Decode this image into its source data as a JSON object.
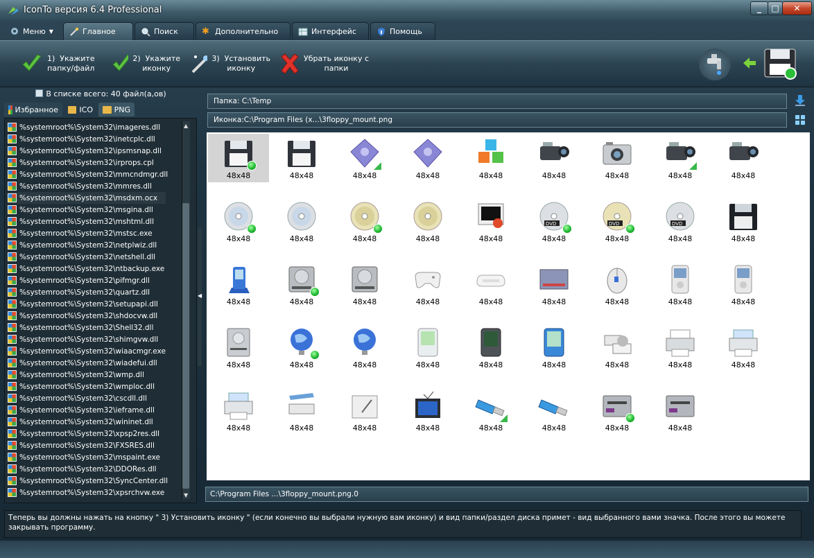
{
  "window": {
    "title": "IconTo версия 6.4 Professional",
    "min": "_",
    "max": "□",
    "close": "✕"
  },
  "tabs": [
    {
      "label": "Меню",
      "icon": "gear-drop-icon",
      "active": false
    },
    {
      "label": "Главное",
      "icon": "wand-icon",
      "active": true
    },
    {
      "label": "Поиск",
      "icon": "magnifier-icon",
      "active": false
    },
    {
      "label": "Дополнительно",
      "icon": "star-icon",
      "active": false
    },
    {
      "label": "Интерфейс",
      "icon": "grid-icon",
      "active": false
    },
    {
      "label": "Помощь",
      "icon": "shield-info-icon",
      "active": false
    }
  ],
  "toolbar": {
    "step1": "1)  Укажите\nпапку/файл",
    "step2": "2)  Укажите\nиконку",
    "step3": "3)  Установить\nиконку",
    "remove": "Убрать иконку с\nпапки"
  },
  "left": {
    "count": "В списке всего: 40 файл(а,ов)",
    "tabs": [
      "Избранное",
      "ICO",
      "PNG"
    ],
    "files": [
      "%systemroot%\\System32\\imageres.dll",
      "%systemroot%\\System32\\inetcplc.dll",
      "%systemroot%\\System32\\ipsmsnap.dll",
      "%systemroot%\\System32\\irprops.cpl",
      "%systemroot%\\System32\\mmcndmgr.dll",
      "%systemroot%\\System32\\mmres.dll",
      "%systemroot%\\System32\\msdxm.ocx",
      "%systemroot%\\System32\\msgina.dll",
      "%systemroot%\\System32\\mshtml.dll",
      "%systemroot%\\System32\\mstsc.exe",
      "%systemroot%\\System32\\netplwiz.dll",
      "%systemroot%\\System32\\netshell.dll",
      "%systemroot%\\System32\\ntbackup.exe",
      "%systemroot%\\System32\\pifmgr.dll",
      "%systemroot%\\System32\\quartz.dll",
      "%systemroot%\\System32\\setupapi.dll",
      "%systemroot%\\System32\\shdocvw.dll",
      "%systemroot%\\System32\\Shell32.dll",
      "%systemroot%\\System32\\shimgvw.dll",
      "%systemroot%\\System32\\wiaacmgr.exe",
      "%systemroot%\\System32\\wiadefui.dll",
      "%systemroot%\\System32\\wmp.dll",
      "%systemroot%\\System32\\wmploc.dll",
      "%systemroot%\\System32\\cscdll.dll",
      "%systemroot%\\System32\\ieframe.dll",
      "%systemroot%\\System32\\wininet.dll",
      "%systemroot%\\System32\\xpsp2res.dll",
      "%systemroot%\\System32\\FXSRES.dll",
      "%systemroot%\\System32\\mspaint.exe",
      "%systemroot%\\System32\\DDORes.dll",
      "%systemroot%\\System32\\SyncCenter.dll",
      "%systemroot%\\System32\\xpsrchvw.exe"
    ]
  },
  "paths": {
    "folder": "Папка: C:\\Temp",
    "icon": "Иконка:C:\\Program Files (x...\\3floppy_mount.png"
  },
  "icons": [
    {
      "name": "floppy-icon",
      "size": "48x48",
      "badge": "ok",
      "sel": true
    },
    {
      "name": "floppy-icon",
      "size": "48x48",
      "badge": ""
    },
    {
      "name": "plugin-puzzle-icon",
      "size": "48x48",
      "badge": "tri"
    },
    {
      "name": "plugin-puzzle-icon",
      "size": "48x48",
      "badge": ""
    },
    {
      "name": "cubes-icon",
      "size": "48x48",
      "badge": ""
    },
    {
      "name": "camcorder-icon",
      "size": "48x48",
      "badge": ""
    },
    {
      "name": "camera-icon",
      "size": "48x48",
      "badge": ""
    },
    {
      "name": "camcorder-icon",
      "size": "48x48",
      "badge": "tri"
    },
    {
      "name": "camcorder-icon",
      "size": "48x48",
      "badge": ""
    },
    {
      "name": "cd-icon",
      "size": "48x48",
      "badge": "ok"
    },
    {
      "name": "cd-icon",
      "size": "48x48",
      "badge": ""
    },
    {
      "name": "cd-gold-icon",
      "size": "48x48",
      "badge": "ok"
    },
    {
      "name": "cd-gold-icon",
      "size": "48x48",
      "badge": ""
    },
    {
      "name": "monitor-icon",
      "size": "48x48",
      "badge": ""
    },
    {
      "name": "dvd-icon",
      "size": "48x48",
      "badge": "ok"
    },
    {
      "name": "dvd-gold-icon",
      "size": "48x48",
      "badge": "ok"
    },
    {
      "name": "dvd-icon",
      "size": "48x48",
      "badge": ""
    },
    {
      "name": "floppy-dark-icon",
      "size": "48x48",
      "badge": ""
    },
    {
      "name": "pda-stand-icon",
      "size": "48x48",
      "badge": ""
    },
    {
      "name": "hard-drive-icon",
      "size": "48x48",
      "badge": "ok"
    },
    {
      "name": "hard-drive-icon",
      "size": "48x48",
      "badge": ""
    },
    {
      "name": "gamepad-icon",
      "size": "48x48",
      "badge": ""
    },
    {
      "name": "keyboard-icon",
      "size": "48x48",
      "badge": ""
    },
    {
      "name": "modem-icon",
      "size": "48x48",
      "badge": ""
    },
    {
      "name": "mouse-icon",
      "size": "48x48",
      "badge": ""
    },
    {
      "name": "media-player-icon",
      "size": "48x48",
      "badge": ""
    },
    {
      "name": "media-player-icon",
      "size": "48x48",
      "badge": ""
    },
    {
      "name": "server-drive-icon",
      "size": "48x48",
      "badge": ""
    },
    {
      "name": "network-globe-icon",
      "size": "48x48",
      "badge": "ok"
    },
    {
      "name": "network-globe-icon",
      "size": "48x48",
      "badge": ""
    },
    {
      "name": "pda-green-icon",
      "size": "48x48",
      "badge": ""
    },
    {
      "name": "pda-dark-icon",
      "size": "48x48",
      "badge": ""
    },
    {
      "name": "pda-blue-icon",
      "size": "48x48",
      "badge": ""
    },
    {
      "name": "printer-network-icon",
      "size": "48x48",
      "badge": ""
    },
    {
      "name": "printer-icon",
      "size": "48x48",
      "badge": ""
    },
    {
      "name": "printer-blue-icon",
      "size": "48x48",
      "badge": ""
    },
    {
      "name": "printer-blue-icon",
      "size": "48x48",
      "badge": ""
    },
    {
      "name": "scanner-icon",
      "size": "48x48",
      "badge": ""
    },
    {
      "name": "tablet-icon",
      "size": "48x48",
      "badge": ""
    },
    {
      "name": "tv-icon",
      "size": "48x48",
      "badge": ""
    },
    {
      "name": "usb-drive-icon",
      "size": "48x48",
      "badge": "tri"
    },
    {
      "name": "usb-drive-icon",
      "size": "48x48",
      "badge": ""
    },
    {
      "name": "floppy-slot-icon",
      "size": "48x48",
      "badge": "ok"
    },
    {
      "name": "floppy-slot-icon",
      "size": "48x48",
      "badge": ""
    }
  ],
  "status": "C:\\Program Files ...\\3floppy_mount.png.0",
  "info": "Теперь вы должны нажать на кнопку \" 3) Установить иконку \" (если конечно вы выбрали нужную вам иконку) и вид папки/раздел диска примет - вид выбранного вами значка. После этого вы можете закрывать программу."
}
